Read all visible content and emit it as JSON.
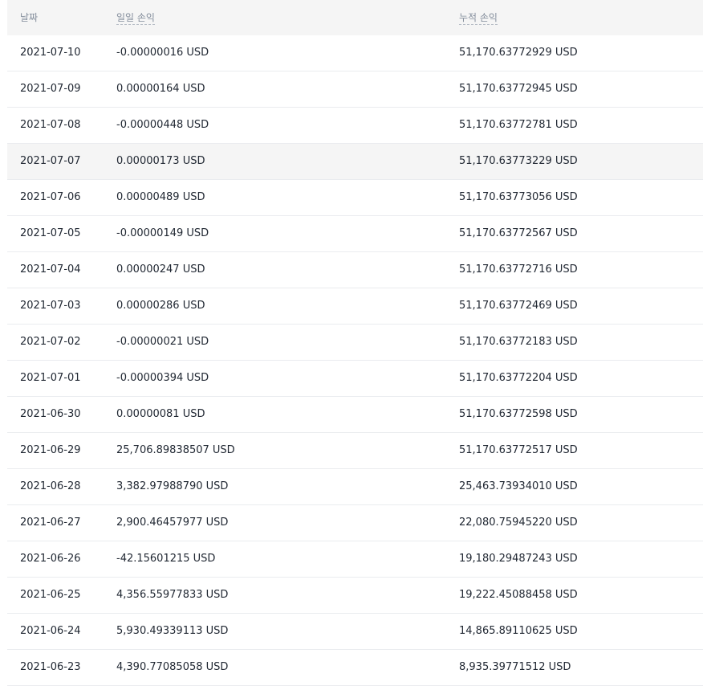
{
  "table": {
    "headers": {
      "date": "날짜",
      "daily_pnl": "일일 손익",
      "cumulative_pnl": "누적 손익"
    },
    "hovered_row_index": 3,
    "rows": [
      {
        "date": "2021-07-10",
        "daily_pnl": "-0.00000016 USD",
        "cumulative_pnl": "51,170.63772929 USD"
      },
      {
        "date": "2021-07-09",
        "daily_pnl": "0.00000164 USD",
        "cumulative_pnl": "51,170.63772945 USD"
      },
      {
        "date": "2021-07-08",
        "daily_pnl": "-0.00000448 USD",
        "cumulative_pnl": "51,170.63772781 USD"
      },
      {
        "date": "2021-07-07",
        "daily_pnl": "0.00000173 USD",
        "cumulative_pnl": "51,170.63773229 USD"
      },
      {
        "date": "2021-07-06",
        "daily_pnl": "0.00000489 USD",
        "cumulative_pnl": "51,170.63773056 USD"
      },
      {
        "date": "2021-07-05",
        "daily_pnl": "-0.00000149 USD",
        "cumulative_pnl": "51,170.63772567 USD"
      },
      {
        "date": "2021-07-04",
        "daily_pnl": "0.00000247 USD",
        "cumulative_pnl": "51,170.63772716 USD"
      },
      {
        "date": "2021-07-03",
        "daily_pnl": "0.00000286 USD",
        "cumulative_pnl": "51,170.63772469 USD"
      },
      {
        "date": "2021-07-02",
        "daily_pnl": "-0.00000021 USD",
        "cumulative_pnl": "51,170.63772183 USD"
      },
      {
        "date": "2021-07-01",
        "daily_pnl": "-0.00000394 USD",
        "cumulative_pnl": "51,170.63772204 USD"
      },
      {
        "date": "2021-06-30",
        "daily_pnl": "0.00000081 USD",
        "cumulative_pnl": "51,170.63772598 USD"
      },
      {
        "date": "2021-06-29",
        "daily_pnl": "25,706.89838507 USD",
        "cumulative_pnl": "51,170.63772517 USD"
      },
      {
        "date": "2021-06-28",
        "daily_pnl": "3,382.97988790 USD",
        "cumulative_pnl": "25,463.73934010 USD"
      },
      {
        "date": "2021-06-27",
        "daily_pnl": "2,900.46457977 USD",
        "cumulative_pnl": "22,080.75945220 USD"
      },
      {
        "date": "2021-06-26",
        "daily_pnl": "-42.15601215 USD",
        "cumulative_pnl": "19,180.29487243 USD"
      },
      {
        "date": "2021-06-25",
        "daily_pnl": "4,356.55977833 USD",
        "cumulative_pnl": "19,222.45088458 USD"
      },
      {
        "date": "2021-06-24",
        "daily_pnl": "5,930.49339113 USD",
        "cumulative_pnl": "14,865.89110625 USD"
      },
      {
        "date": "2021-06-23",
        "daily_pnl": "4,390.77085058 USD",
        "cumulative_pnl": "8,935.39771512 USD"
      }
    ]
  }
}
